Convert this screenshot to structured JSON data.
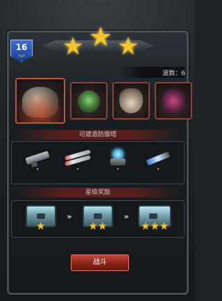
{
  "header": {
    "level": "16",
    "stars_earned": 3,
    "stars_total": 3
  },
  "wave": {
    "label": "波数：6"
  },
  "sections": {
    "towers_title": "可建造防御塔",
    "rewards_title": "星级奖励"
  },
  "towers": [
    {
      "name": "gatling-tower-icon"
    },
    {
      "name": "missile-tower-icon"
    },
    {
      "name": "tesla-tower-icon"
    },
    {
      "name": "laser-tower-icon"
    }
  ],
  "rewards": [
    {
      "stars": "★"
    },
    {
      "stars": "★★"
    },
    {
      "stars": "★★★"
    }
  ],
  "actions": {
    "fight_label": "战斗"
  },
  "colors": {
    "star": "#f3c42b",
    "fight_button": "#a8322a",
    "badge": "#2c5bc0"
  }
}
